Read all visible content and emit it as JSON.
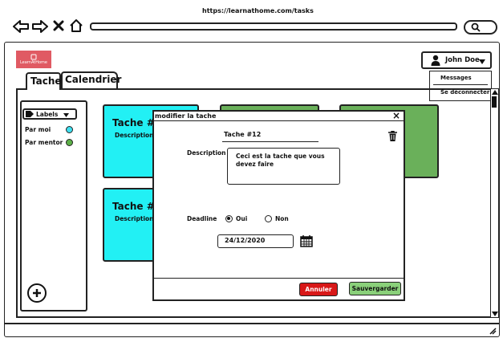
{
  "browser": {
    "url": "https://learnathome.com/tasks"
  },
  "app": {
    "logo_text": "LearnAtHome",
    "user_name": "John Doe",
    "user_menu": [
      "Messages",
      "Se déconnecter"
    ]
  },
  "tabs": [
    {
      "label": "Tache",
      "active": true
    },
    {
      "label": "Calendrier",
      "active": false
    }
  ],
  "sidebar": {
    "labels_button": "Labels",
    "filters": [
      {
        "label": "Par moi",
        "color": "#3fe0f0"
      },
      {
        "label": "Par mentor",
        "color": "#5cb048"
      }
    ]
  },
  "cards": [
    {
      "title": "Tache #1",
      "subtitle": "Description",
      "color": "#22f0f4"
    },
    {
      "title": "",
      "subtitle": "",
      "color": "#6ab05a"
    },
    {
      "title": "",
      "subtitle": "",
      "color": "#6ab05a"
    },
    {
      "title": "Tache #2",
      "subtitle": "Description",
      "color": "#22f0f4"
    }
  ],
  "modal": {
    "title": "modifier la tache",
    "close_symbol": "×",
    "task_name": "Tache #12",
    "description_label": "Description",
    "description_value": "Ceci est la tache que vous devez faire",
    "deadline_label": "Deadline",
    "deadline_options": [
      {
        "label": "Oui",
        "selected": true
      },
      {
        "label": "Non",
        "selected": false
      }
    ],
    "date_value": "24/12/2020",
    "cancel_label": "Annuler",
    "save_label": "Sauvergarder",
    "cancel_color": "#d81818",
    "save_color": "#8ad07a"
  },
  "colors": {
    "logo_bg": "#e05a63",
    "accent_cyan": "#22f0f4",
    "accent_green": "#6ab05a"
  }
}
